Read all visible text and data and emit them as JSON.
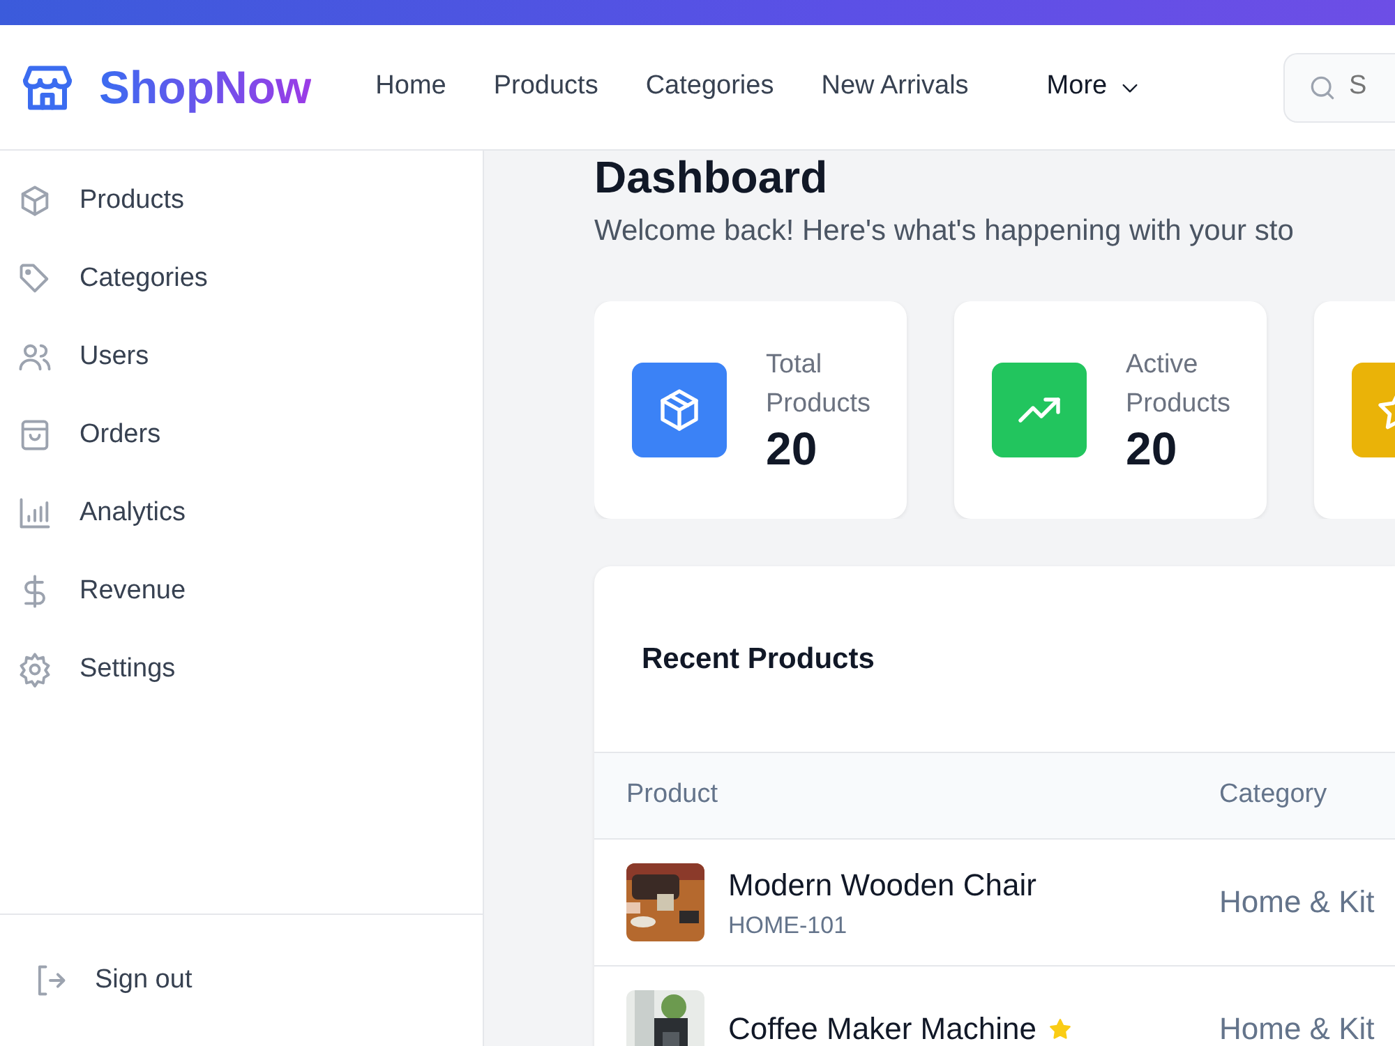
{
  "navbar": {
    "brand": "ShopNow",
    "links": [
      {
        "label": "Home"
      },
      {
        "label": "Products"
      },
      {
        "label": "Categories"
      },
      {
        "label": "New Arrivals"
      }
    ],
    "more": "More",
    "search": {
      "placeholder": "S"
    }
  },
  "sidebar": {
    "items": [
      {
        "label": "Products"
      },
      {
        "label": "Categories"
      },
      {
        "label": "Users"
      },
      {
        "label": "Orders"
      },
      {
        "label": "Analytics"
      },
      {
        "label": "Revenue"
      },
      {
        "label": "Settings"
      }
    ],
    "sign_out": "Sign out"
  },
  "header": {
    "title": "Dashboard",
    "subtitle": "Welcome back! Here's what's happening with your sto"
  },
  "stats": [
    {
      "label": "Total Products",
      "value": "20",
      "color": "#3b82f6"
    },
    {
      "label": "Active Products",
      "value": "20",
      "color": "#22c55e"
    },
    {
      "color": "#eab308"
    }
  ],
  "table": {
    "title": "Recent Products",
    "columns": [
      "Product",
      "Category"
    ],
    "rows": [
      {
        "name": "Modern Wooden Chair",
        "sku": "HOME-101",
        "featured": false,
        "category": "Home & Kit"
      },
      {
        "name": "Coffee Maker Machine",
        "featured": true,
        "category": "Home & Kit"
      }
    ]
  }
}
